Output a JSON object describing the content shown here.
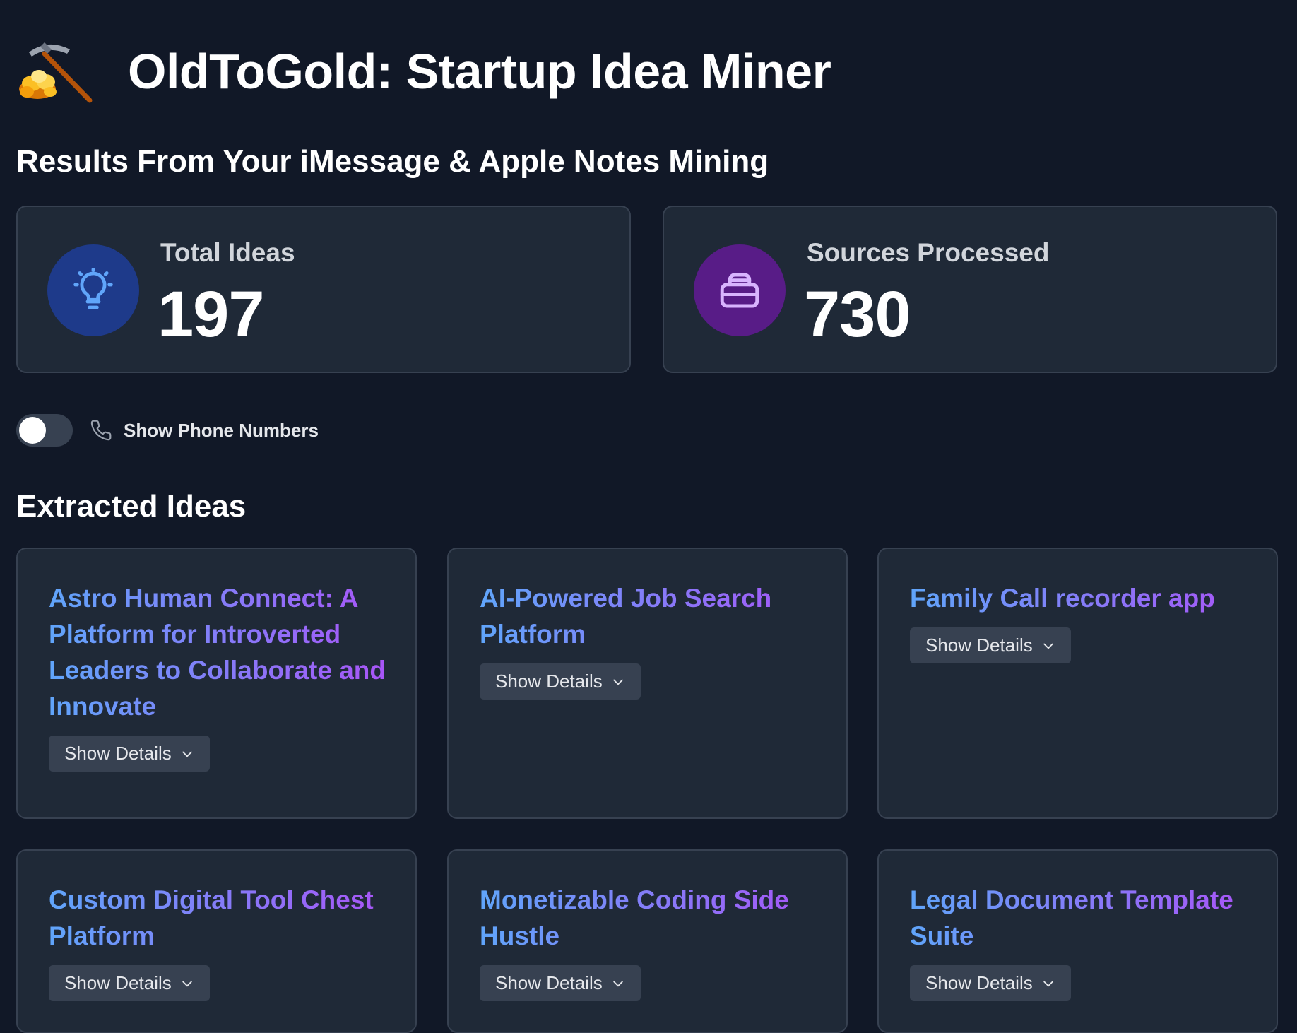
{
  "header": {
    "logo_icon": "pickaxe-gold-icon",
    "title": "OldToGold: Startup Idea Miner"
  },
  "subtitle": "Results From Your iMessage & Apple Notes Mining",
  "stats": {
    "total_ideas": {
      "label": "Total Ideas",
      "value": "197",
      "icon": "lightbulb-icon",
      "color": "#1e3a8a"
    },
    "sources_processed": {
      "label": "Sources Processed",
      "value": "730",
      "icon": "database-icon",
      "color": "#581c87"
    }
  },
  "phone_toggle": {
    "label": "Show Phone Numbers",
    "enabled": false,
    "icon": "phone-icon"
  },
  "ideas_section": {
    "title": "Extracted Ideas",
    "details_label": "Show Details",
    "ideas": [
      {
        "title": "Astro Human Connect: A Platform for Introverted Leaders to Collaborate and Innovate"
      },
      {
        "title": "AI-Powered Job Search Platform"
      },
      {
        "title": "Family Call recorder app"
      },
      {
        "title": "Custom Digital Tool Chest Platform"
      },
      {
        "title": "Monetizable Coding Side Hustle"
      },
      {
        "title": "Legal Document Template Suite"
      }
    ]
  },
  "colors": {
    "background": "#111827",
    "card": "#1f2937",
    "border": "#374151",
    "gradient_start": "#60a5fa",
    "gradient_end": "#a855f7"
  }
}
